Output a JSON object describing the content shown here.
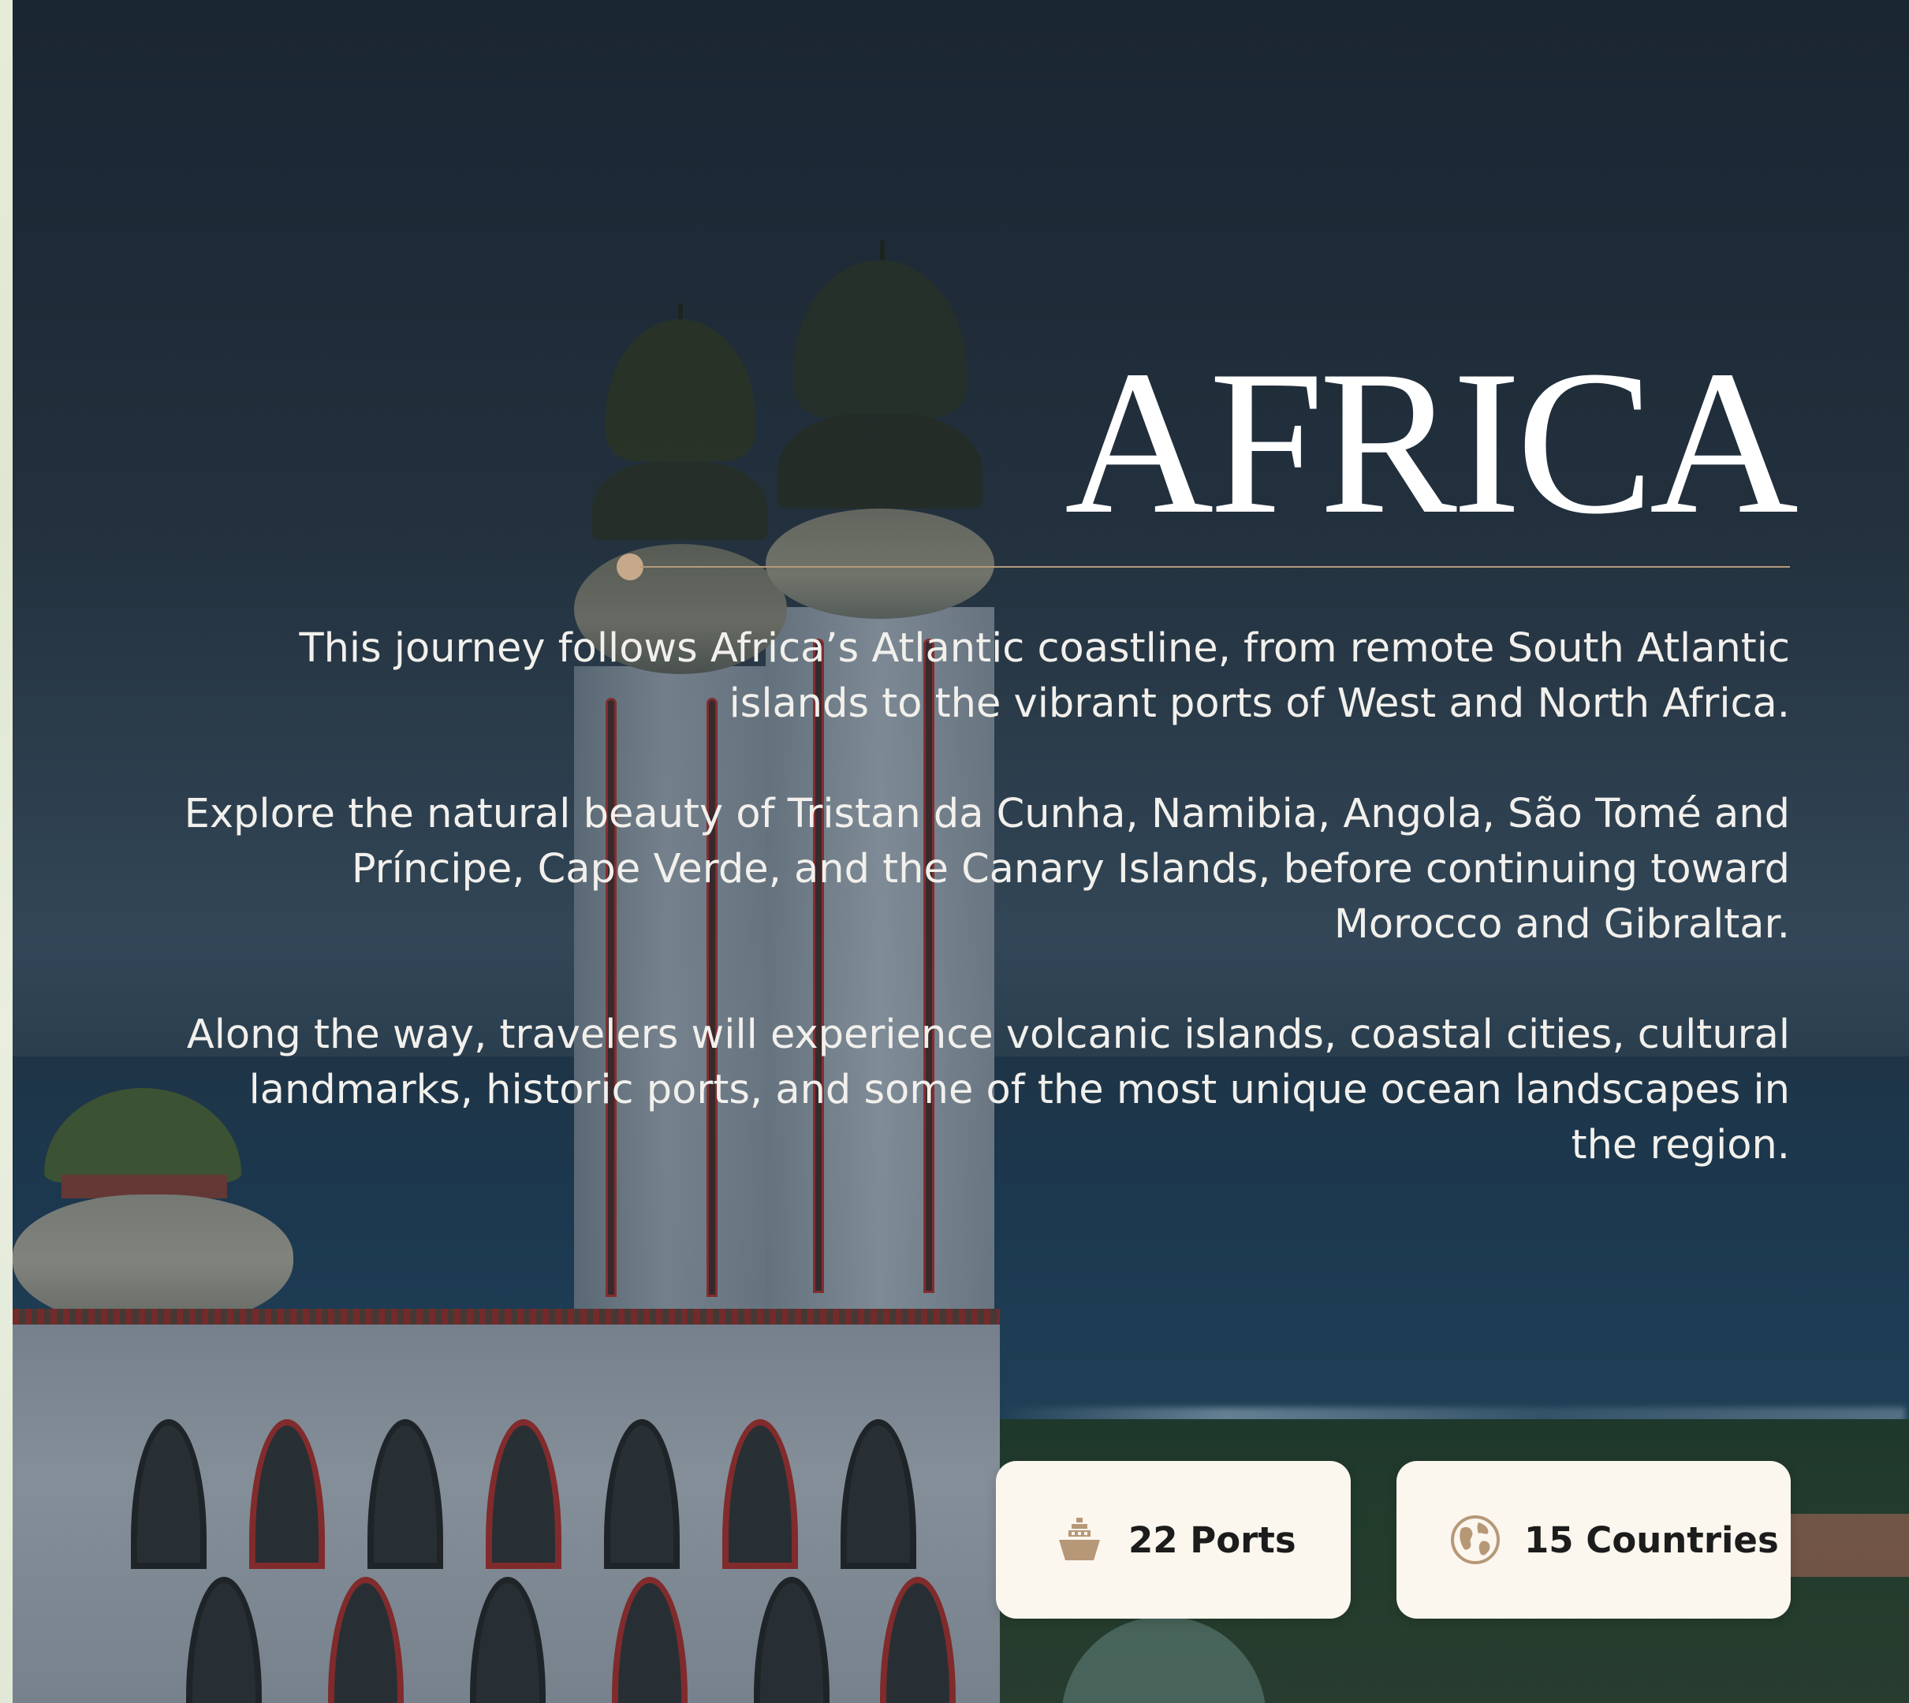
{
  "hero": {
    "title": "AFRICA",
    "paragraphs": [
      "This journey follows Africa’s Atlantic coastline, from remote South Atlantic islands to the vibrant ports of West and North Africa.",
      "Explore the natural beauty of Tristan da Cunha, Namibia, Angola, São Tomé and Príncipe, Cape Verde, and the Canary Islands, before continuing toward Morocco and Gibraltar.",
      "Along the way, travelers will experience volcanic islands, coastal cities, cultural landmarks, historic ports, and some of the most unique ocean landscapes in the region."
    ]
  },
  "stats": [
    {
      "icon": "ship-icon",
      "label": "22 Ports"
    },
    {
      "icon": "globe-icon",
      "label": "15 Countries"
    }
  ],
  "colors": {
    "accent": "#c6a98a",
    "card_bg": "#fbf6ee",
    "overlay": "#1d2a38",
    "text_light": "#ffffff"
  }
}
